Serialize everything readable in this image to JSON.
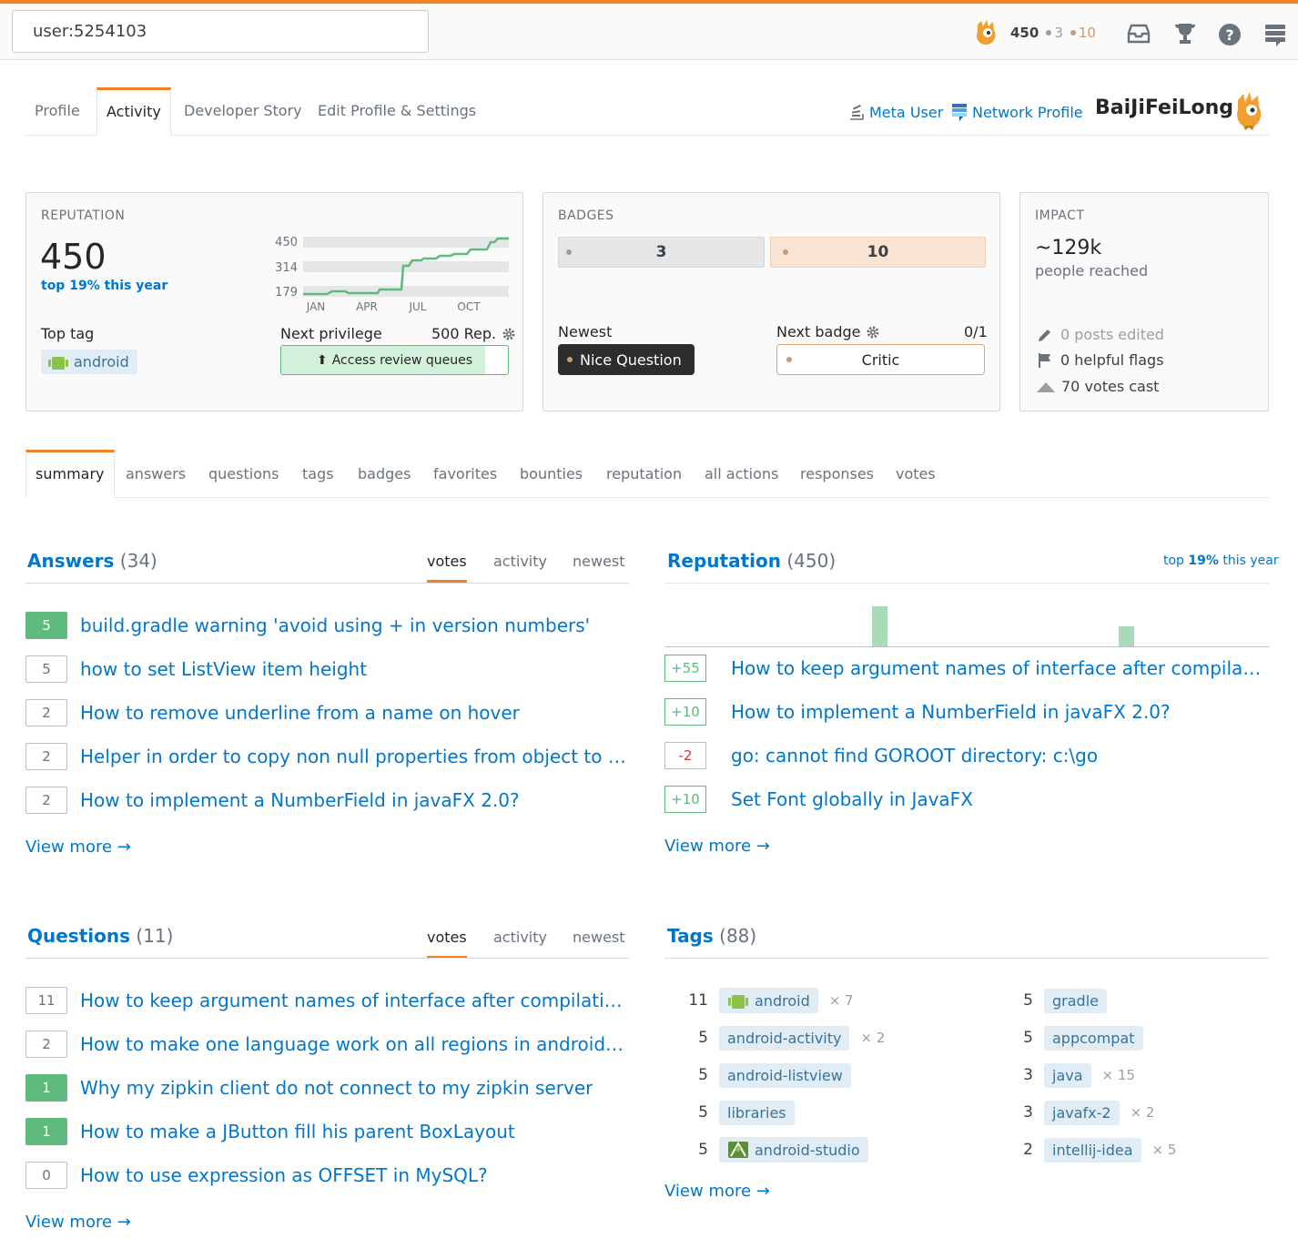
{
  "topbar": {
    "search_value": "user:5254103",
    "reputation": "450",
    "silver_count": "3",
    "bronze_count": "10",
    "icons": [
      "inbox-icon",
      "trophy-icon",
      "help-icon",
      "stackexchange-icon"
    ]
  },
  "profile_tabs": [
    "Profile",
    "Activity",
    "Developer Story",
    "Edit Profile & Settings"
  ],
  "header_links": {
    "meta_user": "Meta User",
    "network_profile": "Network Profile",
    "username": "BaiJiFeiLong"
  },
  "reputation_card": {
    "caption": "REPUTATION",
    "value": "450",
    "rank_prefix": "top",
    "rank_pct": "19%",
    "rank_suffix": "this year",
    "chart_y_labels": [
      "450",
      "314",
      "179"
    ],
    "chart_x_labels": [
      "JAN",
      "APR",
      "JUL",
      "OCT"
    ],
    "top_tag_label": "Top tag",
    "top_tag": "android",
    "next_privilege_label": "Next privilege",
    "next_privilege_rep": "500 Rep.",
    "privilege_name": "Access review queues",
    "privilege_progress": 0.9
  },
  "badges_card": {
    "caption": "BADGES",
    "silver": "3",
    "bronze": "10",
    "newest_label": "Newest",
    "newest_badge": "Nice Question",
    "next_badge_label": "Next badge",
    "next_badge_progress": "0/1",
    "next_badge": "Critic"
  },
  "impact_card": {
    "caption": "IMPACT",
    "reach": "~129k",
    "reach_label": "people reached",
    "posts_edited": "0 posts edited",
    "helpful_flags": "0 helpful flags",
    "votes_cast": "70 votes cast"
  },
  "section_tabs": [
    "summary",
    "answers",
    "questions",
    "tags",
    "badges",
    "favorites",
    "bounties",
    "reputation",
    "all actions",
    "responses",
    "votes"
  ],
  "answers": {
    "title": "Answers",
    "count": "(34)",
    "filters": [
      "votes",
      "activity",
      "newest"
    ],
    "items": [
      {
        "votes": "5",
        "accepted": true,
        "title": "build.gradle warning 'avoid using + in version numbers'"
      },
      {
        "votes": "5",
        "accepted": false,
        "title": "how to set ListView item height"
      },
      {
        "votes": "2",
        "accepted": false,
        "title": "How to remove underline from a name on hover"
      },
      {
        "votes": "2",
        "accepted": false,
        "title": "Helper in order to copy non null properties from object to …"
      },
      {
        "votes": "2",
        "accepted": false,
        "title": "How to implement a NumberField in javaFX 2.0?"
      }
    ],
    "view_more": "View more →"
  },
  "reputation_section": {
    "title": "Reputation",
    "count": "(450)",
    "rank_prefix": "top",
    "rank_pct": "19%",
    "rank_suffix": "this year",
    "items": [
      {
        "change": "+55",
        "title": "How to keep argument names of interface after compilatio…"
      },
      {
        "change": "+10",
        "title": "How to implement a NumberField in javaFX 2.0?"
      },
      {
        "change": "-2",
        "title": "go: cannot find GOROOT directory: c:\\go"
      },
      {
        "change": "+10",
        "title": "Set Font globally in JavaFX"
      }
    ],
    "view_more": "View more →"
  },
  "questions": {
    "title": "Questions",
    "count": "(11)",
    "filters": [
      "votes",
      "activity",
      "newest"
    ],
    "items": [
      {
        "votes": "11",
        "accepted": false,
        "title": "How to keep argument names of interface after compilatio…"
      },
      {
        "votes": "2",
        "accepted": false,
        "title": "How to make one language work on all regions in android l…"
      },
      {
        "votes": "1",
        "accepted": true,
        "title": "Why my zipkin client do not connect to my zipkin server"
      },
      {
        "votes": "1",
        "accepted": true,
        "title": "How to make a JButton fill his parent BoxLayout"
      },
      {
        "votes": "0",
        "accepted": false,
        "title": "How to use expression as OFFSET in MySQL?"
      }
    ],
    "view_more": "View more →"
  },
  "tags": {
    "title": "Tags",
    "count": "(88)",
    "left": [
      {
        "score": "11",
        "name": "android",
        "mult": "× 7"
      },
      {
        "score": "5",
        "name": "android-activity",
        "mult": "× 2"
      },
      {
        "score": "5",
        "name": "android-listview",
        "mult": ""
      },
      {
        "score": "5",
        "name": "libraries",
        "mult": ""
      },
      {
        "score": "5",
        "name": "android-studio",
        "mult": ""
      }
    ],
    "right": [
      {
        "score": "5",
        "name": "gradle",
        "mult": ""
      },
      {
        "score": "5",
        "name": "appcompat",
        "mult": ""
      },
      {
        "score": "3",
        "name": "java",
        "mult": "× 15"
      },
      {
        "score": "3",
        "name": "javafx-2",
        "mult": "× 2"
      },
      {
        "score": "2",
        "name": "intellij-idea",
        "mult": "× 5"
      }
    ],
    "view_more": "View more →"
  },
  "colors": {
    "accent": "#f48024",
    "link": "#0077cc",
    "accepted": "#5eba7d"
  }
}
